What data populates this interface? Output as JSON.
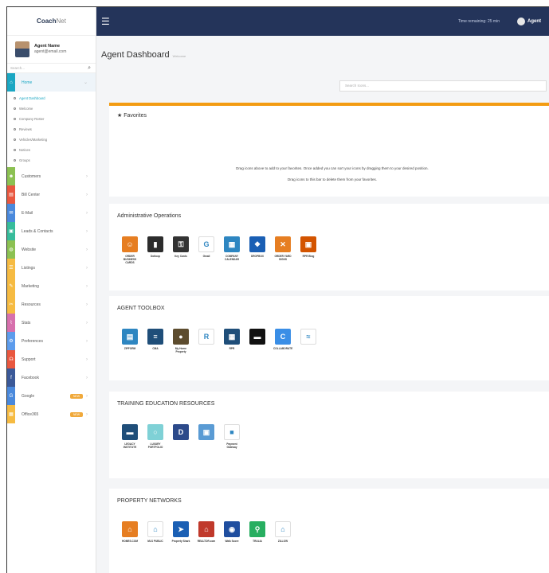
{
  "brand": {
    "name_part1": "Coach",
    "name_part2": "Net"
  },
  "profile": {
    "name": "Agent Name",
    "email": "agent@email.com"
  },
  "sidebar_search": {
    "placeholder": "Search..."
  },
  "sidebar": {
    "home": {
      "label": "Home",
      "icon": "home-icon",
      "color": "#1ba7c3"
    },
    "home_sub": [
      {
        "label": "Agent Dashboard"
      },
      {
        "label": "Welcome"
      },
      {
        "label": "Company Roster"
      },
      {
        "label": "Reviews"
      },
      {
        "label": "Vehicles/Marketing"
      },
      {
        "label": "Notices"
      },
      {
        "label": "Groups"
      }
    ],
    "items": [
      {
        "label": "Customers",
        "icon": "users-icon",
        "color": "#8cc152"
      },
      {
        "label": "Bill Center",
        "icon": "list-icon",
        "color": "#e9573f"
      },
      {
        "label": "E-Mail",
        "icon": "mail-icon",
        "color": "#4a89dc"
      },
      {
        "label": "Leads & Contacts",
        "icon": "contact-icon",
        "color": "#37bc9b"
      },
      {
        "label": "Website",
        "icon": "globe-icon",
        "color": "#8cc152"
      },
      {
        "label": "Listings",
        "icon": "listings-icon",
        "color": "#f6bb42"
      },
      {
        "label": "Marketing",
        "icon": "megaphone-icon",
        "color": "#f6bb42"
      },
      {
        "label": "Resources",
        "icon": "wrench-icon",
        "color": "#f6bb42"
      },
      {
        "label": "Stats",
        "icon": "chart-icon",
        "color": "#d770ad"
      },
      {
        "label": "Preferences",
        "icon": "gear-icon",
        "color": "#5d9cec"
      },
      {
        "label": "Support",
        "icon": "headset-icon",
        "color": "#e9573f"
      },
      {
        "label": "Facebook",
        "icon": "facebook-icon",
        "color": "#3b5998"
      },
      {
        "label": "Google",
        "icon": "google-icon",
        "color": "#4a89dc",
        "badge": "NEW"
      },
      {
        "label": "Office365",
        "icon": "office-icon",
        "color": "#f6bb42",
        "badge": "NEW"
      }
    ]
  },
  "topbar": {
    "timer": "Time remaining: 25 min",
    "user": "Agent"
  },
  "page": {
    "title": "Agent Dashboard",
    "subtitle": "Welcome"
  },
  "main_search": {
    "placeholder": "Search Icons..."
  },
  "favorites": {
    "title": "Favorites",
    "msg1": "Drag icons above to add to your favorites. Once added you can sort your icons by dragging them to your desired position.",
    "msg2": "Drag icons to this bar to delete them from your favorites."
  },
  "sections": [
    {
      "title": "Administrative Operations",
      "tiles": [
        {
          "label": "ORDER BUSINESS CARDS",
          "icon": "business-cards-icon",
          "color": "#e67e22",
          "glyph": "☺"
        },
        {
          "label": "Dotloop",
          "icon": "dotloop-icon",
          "color": "#2c2c2c",
          "glyph": "▮"
        },
        {
          "label": "Key Cards",
          "icon": "key-card-icon",
          "color": "#333333",
          "glyph": "⚿"
        },
        {
          "label": "Gmail",
          "icon": "gmail-icon",
          "color": "#ffffff",
          "glyph": "G"
        },
        {
          "label": "COMPANY CALENDAR",
          "icon": "calendar-icon",
          "color": "#2e86c1",
          "glyph": "▦"
        },
        {
          "label": "DROPBOX",
          "icon": "dropbox-icon",
          "color": "#1a5fb4",
          "glyph": "❖"
        },
        {
          "label": "ORDER YARD SIGNS",
          "icon": "yard-sign-icon",
          "color": "#e67e22",
          "glyph": "✕"
        },
        {
          "label": "RPR Blog",
          "icon": "rpr-icon",
          "color": "#d35400",
          "glyph": "▣"
        }
      ]
    },
    {
      "title": "AGENT TOOLBOX",
      "tiles": [
        {
          "label": "ZIPFORM",
          "icon": "zipform-icon",
          "color": "#2e86c1",
          "glyph": "▤"
        },
        {
          "label": "CMA",
          "icon": "cma-icon",
          "color": "#1f4e79",
          "glyph": "≡"
        },
        {
          "label": "My Home Property",
          "icon": "home-property-icon",
          "color": "#5d4c2e",
          "glyph": "●"
        },
        {
          "label": "",
          "icon": "realpro-icon",
          "color": "#ffffff",
          "glyph": "R"
        },
        {
          "label": "RPR",
          "icon": "rpr-toolbox-icon",
          "color": "#1f4e79",
          "glyph": "▦"
        },
        {
          "label": "",
          "icon": "black-bar-icon",
          "color": "#111111",
          "glyph": "▬"
        },
        {
          "label": "COLLABORATE",
          "icon": "collaborate-icon",
          "color": "#3a8ee6",
          "glyph": "C"
        },
        {
          "label": "",
          "icon": "crm-icon",
          "color": "#ffffff",
          "glyph": "≈"
        }
      ]
    },
    {
      "title": "TRAINING EDUCATION RESOURCES",
      "tiles": [
        {
          "label": "LEGACY INSTITUTE",
          "icon": "legacy-institute-icon",
          "color": "#1f4e79",
          "glyph": "▬"
        },
        {
          "label": "LUXURY PORTFOLIO",
          "icon": "luxury-portfolio-icon",
          "color": "#7fd1d6",
          "glyph": "○"
        },
        {
          "label": "",
          "icon": "dolxo-icon",
          "color": "#2c4a8a",
          "glyph": "D"
        },
        {
          "label": "",
          "icon": "video-icon",
          "color": "#5a9bd4",
          "glyph": "▣"
        },
        {
          "label": "Payment Gateway",
          "icon": "payment-icon",
          "color": "#ffffff",
          "glyph": "■"
        }
      ]
    },
    {
      "title": "PROPERTY NETWORKS",
      "tiles": [
        {
          "label": "HOMES.COM",
          "icon": "homes-com-icon",
          "color": "#e67e22",
          "glyph": "⌂"
        },
        {
          "label": "MLS PUBLIC",
          "icon": "mls-public-icon",
          "color": "#ffffff",
          "glyph": "⌂"
        },
        {
          "label": "Property Shark",
          "icon": "property-shark-icon",
          "color": "#1a5fb4",
          "glyph": "➤"
        },
        {
          "label": "REALTOR.com",
          "icon": "realtor-icon",
          "color": "#c0392b",
          "glyph": "⌂"
        },
        {
          "label": "Walk Score",
          "icon": "walk-score-icon",
          "color": "#1f4e9f",
          "glyph": "◉"
        },
        {
          "label": "TRULIA",
          "icon": "trulia-icon",
          "color": "#27ae60",
          "glyph": "⚲"
        },
        {
          "label": "ZILLOW",
          "icon": "zillow-icon",
          "color": "#ffffff",
          "glyph": "⌂"
        }
      ]
    }
  ]
}
